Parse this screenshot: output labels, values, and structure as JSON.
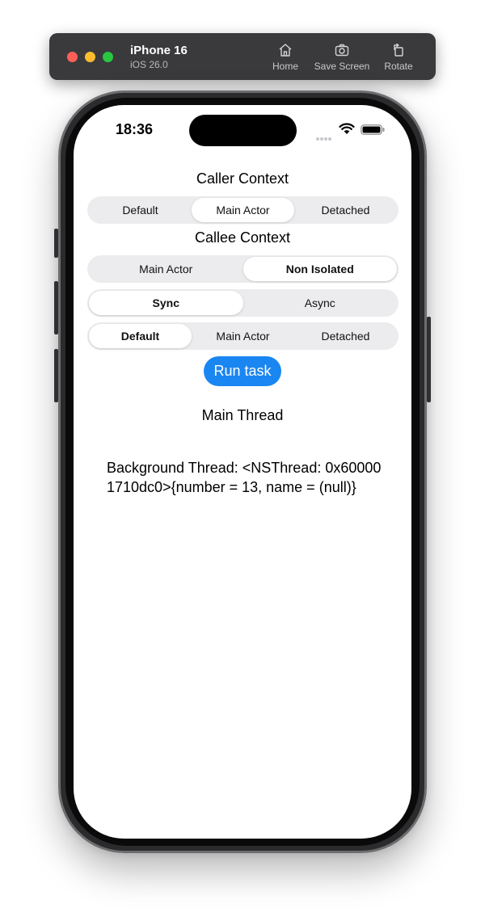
{
  "simulator": {
    "device_name": "iPhone 16",
    "os_version": "iOS 26.0",
    "toolbar": {
      "home_label": "Home",
      "save_screen_label": "Save Screen",
      "rotate_label": "Rotate"
    }
  },
  "status_bar": {
    "time": "18:36"
  },
  "app": {
    "caller_context": {
      "title": "Caller Context",
      "options": [
        "Default",
        "Main Actor",
        "Detached"
      ],
      "selected": "Main Actor"
    },
    "callee_context": {
      "title": "Callee Context",
      "options": [
        "Main Actor",
        "Non Isolated"
      ],
      "selected": "Non Isolated"
    },
    "call_mode": {
      "options": [
        "Sync",
        "Async"
      ],
      "selected": "Sync"
    },
    "task_kind": {
      "options": [
        "Default",
        "Main Actor",
        "Detached"
      ],
      "selected": "Default"
    },
    "run_button_label": "Run task",
    "main_thread_text": "Main Thread",
    "background_thread_text": "Background Thread: <NSThread: 0x600001710dc0>{number = 13, name = (null)}"
  },
  "colors": {
    "accent": "#1a86f2",
    "segment_background": "#ececee",
    "toolbar_background": "#3a3a3c"
  }
}
